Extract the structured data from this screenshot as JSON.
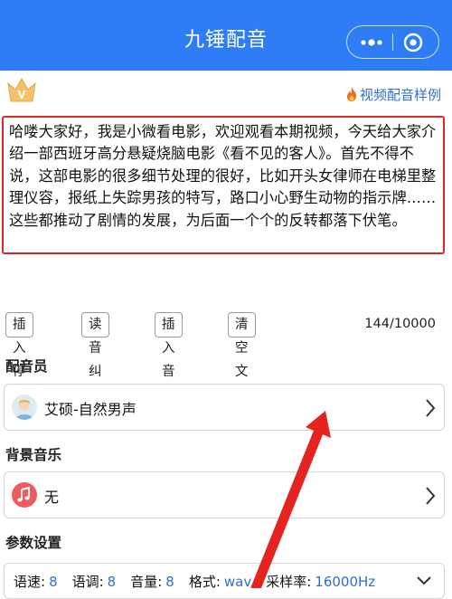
{
  "header": {
    "title": "九锤配音"
  },
  "subbar": {
    "example_link": "视频配音样例",
    "vip_badge": "V"
  },
  "text_input": {
    "value": "哈喽大家好，我是小微看电影，欢迎观看本期视频，今天给大家介绍一部西班牙高分悬疑烧脑电影《看不见的客人》。首先不得不说，这部电影的很多细节处理的很好，比如开头女律师在电梯里整理仪容，报纸上失踪男孩的特写，路口小心野生动物的指示牌……这些都推动了剧情的发展，为后面一个个的反转都落下伏笔。"
  },
  "toolbar": {
    "buttons": [
      "插入停顿",
      "读音纠正",
      "插入音效",
      "清空文本"
    ],
    "counter": "144/10000"
  },
  "voice_section": {
    "title": "配音员",
    "selected": "艾硕-自然男声"
  },
  "music_section": {
    "title": "背景音乐",
    "selected": "无"
  },
  "params_section": {
    "title": "参数设置",
    "params": [
      {
        "key": "语速:",
        "value": "8"
      },
      {
        "key": "语调:",
        "value": "8"
      },
      {
        "key": "音量:",
        "value": "8"
      },
      {
        "key": "格式:",
        "value": "wav"
      },
      {
        "key": "采样率:",
        "value": "16000Hz"
      }
    ]
  },
  "colors": {
    "accent": "#2f7df6",
    "link": "#2f6fd8",
    "highlight": "#e0262b",
    "music": "#f05a5a"
  }
}
